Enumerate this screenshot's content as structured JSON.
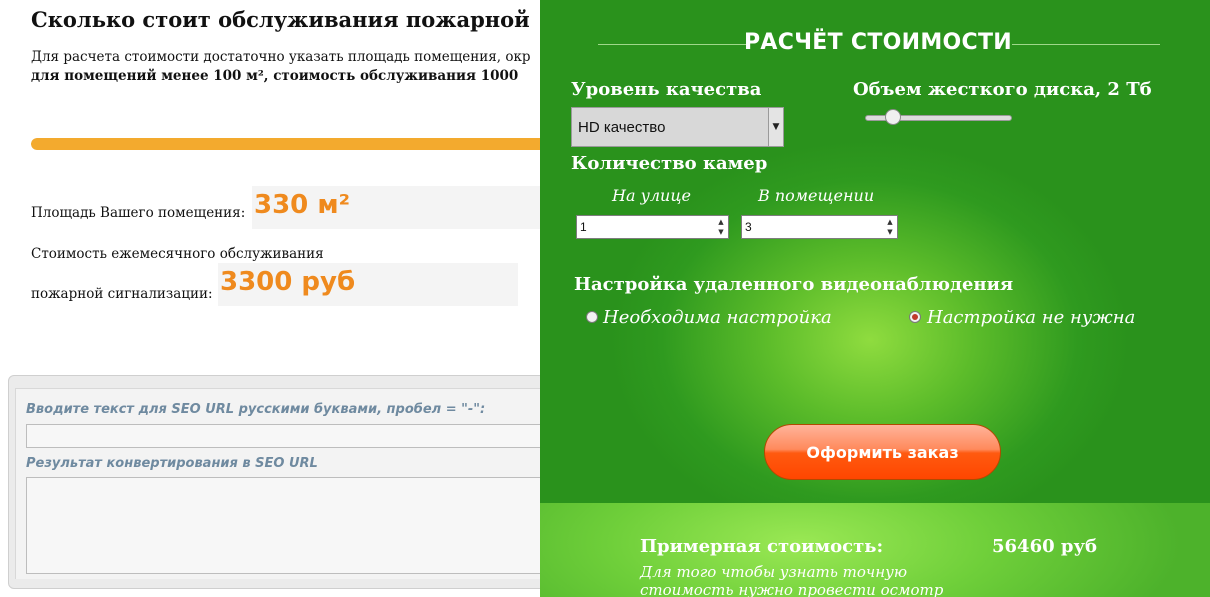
{
  "left": {
    "heading": "Сколько стоит обслуживания пожарной",
    "intro_line1": "Для расчета стоимости достаточно указать площадь помещения, окр",
    "intro_line2": "для помещений менее 100 м², стоимость обслуживания 1000",
    "area_label": "Площадь Вашего помещения:",
    "area_value": "330 м²",
    "cost_label_line1": "Стоимость ежемесячного обслуживания",
    "cost_label_line2": "пожарной сигнализации:",
    "cost_value": "3300 руб",
    "seo_input_label": "Вводите текст для SEO URL русскими буквами, пробел = \"-\":",
    "seo_input_value": "",
    "seo_result_label": "Результат конвертирования в SEO URL",
    "seo_result_value": ""
  },
  "calc": {
    "title": "РАСЧЁТ СТОИМОСТИ",
    "quality_label": "Уровень качества",
    "quality_selected": "HD качество",
    "disk_label": "Объем жесткого диска, 2 Тб",
    "disk_value_tb": 2,
    "cameras_label": "Количество камер",
    "outdoor_label": "На улице",
    "outdoor_value": "1",
    "indoor_label": "В помещении",
    "indoor_value": "3",
    "remote_label": "Настройка удаленного видеонаблюдения",
    "radio_needed": "Необходима настройка",
    "radio_not_needed": "Настройка не нужна",
    "radio_selected": "not_needed",
    "order_button": "Оформить заказ",
    "price_label": "Примерная стоимость:",
    "price_value": "56460 руб",
    "note": "Для того чтобы узнать точную стоимость нужно провести осмотр"
  },
  "colors": {
    "accent_orange": "#ef8a1e",
    "calc_green": "#2f9a1f",
    "button_orange": "#ff5a10"
  }
}
